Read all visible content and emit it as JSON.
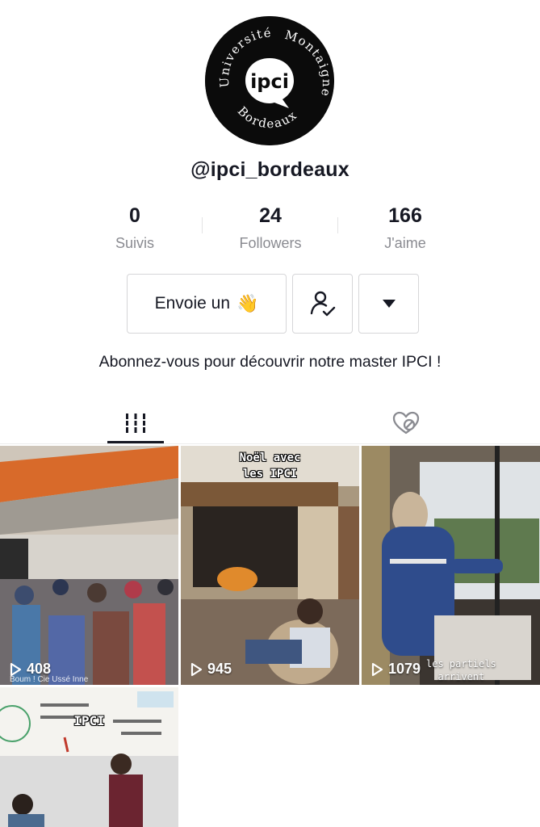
{
  "profile": {
    "avatar_text_top": "Université",
    "avatar_text_right": "Montaigne",
    "avatar_text_bottom": "Bordeaux",
    "avatar_logo": "ipci",
    "username": "@ipci_bordeaux",
    "bio": "Abonnez-vous pour découvrir notre master IPCI !"
  },
  "stats": {
    "following_count": "0",
    "following_label": "Suivis",
    "followers_count": "24",
    "followers_label": "Followers",
    "likes_count": "166",
    "likes_label": "J'aime"
  },
  "actions": {
    "message_label": "Envoie un",
    "message_emoji": "👋",
    "follow_icon": "person-check-icon",
    "more_icon": "caret-down-icon"
  },
  "tabs": {
    "videos_icon": "grid-bars-icon",
    "liked_icon": "heart-hidden-icon"
  },
  "videos": [
    {
      "views": "408",
      "overlay_small": "Boum ! Cie Ussé Inne"
    },
    {
      "views": "945",
      "caption_top_1": "Noël avec",
      "caption_top_2": "les IPCI"
    },
    {
      "views": "1079",
      "caption_bottom_1": "les partiels",
      "caption_bottom_2": "arrivent"
    },
    {
      "caption_top_1": "IPCI"
    }
  ]
}
